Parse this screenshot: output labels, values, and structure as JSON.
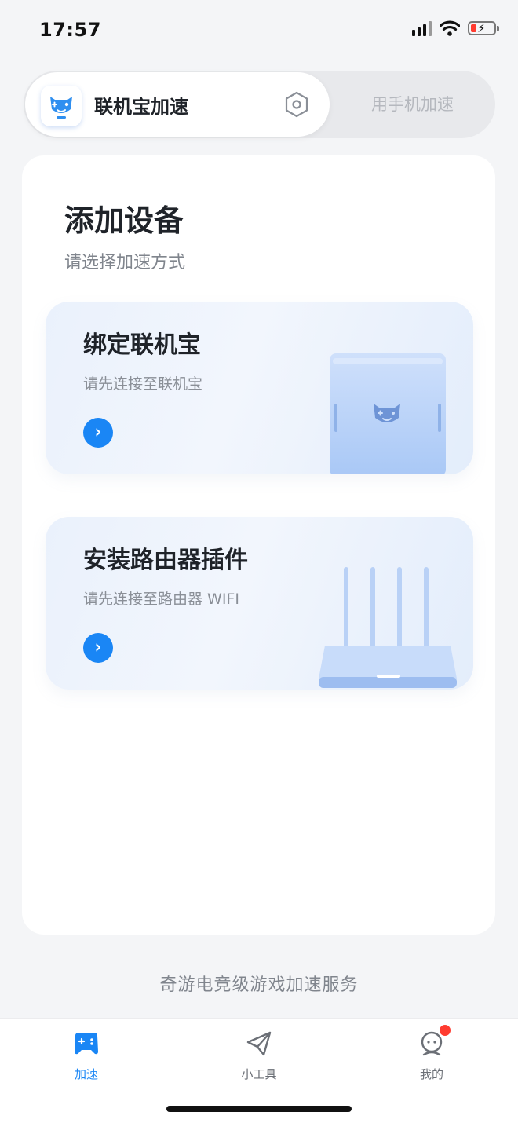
{
  "status_bar": {
    "time": "17:57",
    "battery_color": "#ff3b30"
  },
  "mode_switch": {
    "active_label": "联机宝加速",
    "inactive_label": "用手机加速",
    "settings_icon": "hexagon-settings-icon",
    "device_icon": "game-cat-logo-icon"
  },
  "main": {
    "title": "添加设备",
    "subtitle": "请选择加速方式",
    "options": [
      {
        "title": "绑定联机宝",
        "desc": "请先连接至联机宝",
        "action_icon": "chevron-right-icon"
      },
      {
        "title": "安装路由器插件",
        "desc": "请先连接至路由器 WIFI",
        "action_icon": "chevron-right-icon"
      }
    ]
  },
  "footer": {
    "tagline": "奇游电竞级游戏加速服务"
  },
  "tab_bar": {
    "tabs": [
      {
        "label": "加速",
        "icon": "gamepad-icon",
        "active": true
      },
      {
        "label": "小工具",
        "icon": "paper-plane-icon",
        "active": false
      },
      {
        "label": "我的",
        "icon": "profile-icon",
        "active": false,
        "badge": true
      }
    ],
    "accent": "#1a86f5",
    "badge_color": "#ff3b30"
  }
}
